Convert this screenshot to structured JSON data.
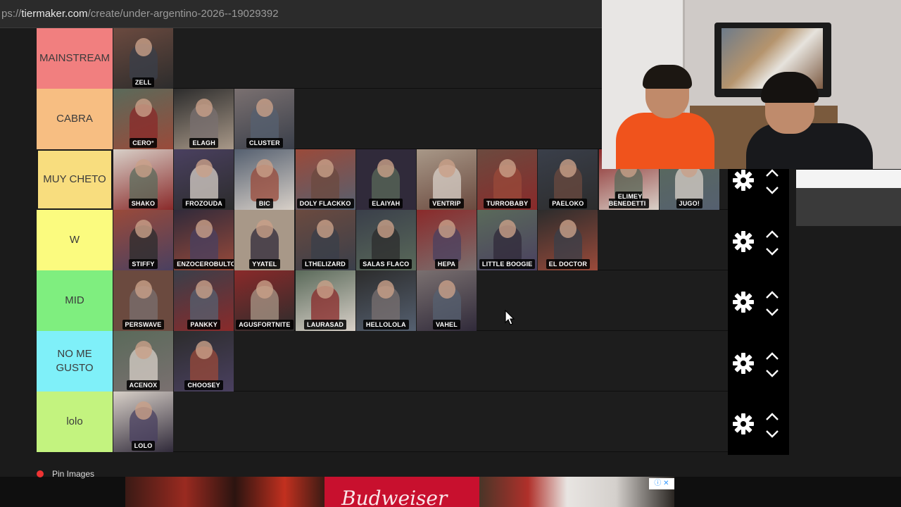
{
  "url": {
    "prefix": "ps://",
    "host": "tiermaker.com",
    "path": "/create/under-argentino-2026--19029392"
  },
  "tiers": [
    {
      "label": "MAINSTREAM",
      "color": "#f17f7f",
      "items": [
        "ZELL"
      ]
    },
    {
      "label": "CABRA",
      "color": "#f7be82",
      "items": [
        "CERO°",
        "ELAGH",
        "CLUSTER"
      ]
    },
    {
      "label": "MUY CHETO",
      "color": "#f8dd7e",
      "items": [
        "SHAKO",
        "FROZOUDA",
        "BIC",
        "DOLY FLACKKO",
        "ELAIYAH",
        "VENTRIP",
        "TURROBABY",
        "PAELOKO",
        "ELIMEY BENEDETTI",
        "JUGO!"
      ]
    },
    {
      "label": "W",
      "color": "#fbfb7f",
      "items": [
        "STIFFY",
        "ENZOCEROBULTO",
        "YYATEL",
        "LTHELIZARD",
        "SALAS FLACO",
        "HEPA",
        "LITTLE BOOGIE",
        "EL DOCTOR"
      ]
    },
    {
      "label": "MID",
      "color": "#7fee7f",
      "items": [
        "PERSWAVE",
        "PANKKY",
        "AGUSFORTNITE",
        "LAURASAD",
        "HELLOLOLA",
        "VAHEL"
      ]
    },
    {
      "label": "NO ME GUSTO",
      "color": "#7ff0f9",
      "items": [
        "ACENOX",
        "CHOOSEY"
      ]
    },
    {
      "label": "lolo",
      "color": "#c3f37f",
      "items": [
        "LOLO"
      ]
    }
  ],
  "controls_icons": {
    "settings": "gear-icon",
    "up": "chevron-up-icon",
    "down": "chevron-down-icon"
  },
  "pin_label": "Pin Images",
  "ad": {
    "brand_text": "Budweiser",
    "info": "ⓘ ✕"
  }
}
